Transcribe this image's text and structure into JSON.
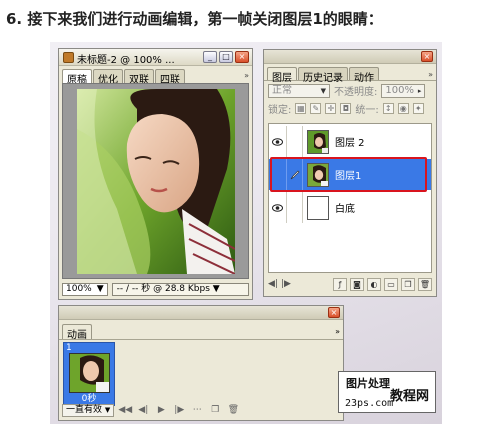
{
  "instruction": "6. 接下来我们进行动画编辑，第一帧关闭图层1的眼睛：",
  "document": {
    "title": "未标题-2 @ 100% ...",
    "tabs": [
      "原稿",
      "优化",
      "双联",
      "四联"
    ],
    "zoom": "100%",
    "status": "-- / -- 秒 @ 28.8 Kbps"
  },
  "layers_palette": {
    "tabs": [
      "图层",
      "历史记录",
      "动作"
    ],
    "blend_mode": "正常",
    "opacity_label": "不透明度:",
    "opacity_value": "100%",
    "lock_label": "锁定:",
    "unify_label": "统一:",
    "layers": [
      {
        "name": "图层 2",
        "visible": true,
        "selected": false
      },
      {
        "name": "图层1",
        "visible": false,
        "selected": true
      },
      {
        "name": "白底",
        "visible": true,
        "selected": false
      }
    ]
  },
  "animation_palette": {
    "tab": "动画",
    "frames": [
      {
        "number": "1",
        "delay": "0秒"
      }
    ],
    "loop": "一直有效"
  },
  "watermark": {
    "line1": "图片处理",
    "line2": "教程网",
    "line3": "23ps.com"
  },
  "colors": {
    "selection_blue": "#3a79e6",
    "highlight_red": "#d9141e"
  }
}
